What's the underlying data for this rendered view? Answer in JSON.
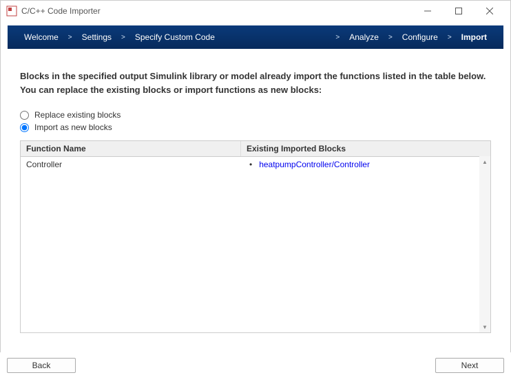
{
  "window": {
    "title": "C/C++ Code Importer"
  },
  "breadcrumb": {
    "items": [
      "Welcome",
      "Settings",
      "Specify Custom Code",
      "Analyze",
      "Configure",
      "Import"
    ],
    "active_index": 5
  },
  "intro_text": "Blocks in the specified output Simulink library or model already import the functions listed in the table below. You can replace the existing blocks or import functions as new blocks:",
  "radios": {
    "replace_label": "Replace existing blocks",
    "import_label": "Import as new blocks",
    "selected": "import"
  },
  "table": {
    "headers": {
      "function": "Function Name",
      "blocks": "Existing Imported Blocks"
    },
    "rows": [
      {
        "function": "Controller",
        "block_link": "heatpumpController/Controller"
      }
    ]
  },
  "footer": {
    "back": "Back",
    "next": "Next"
  }
}
